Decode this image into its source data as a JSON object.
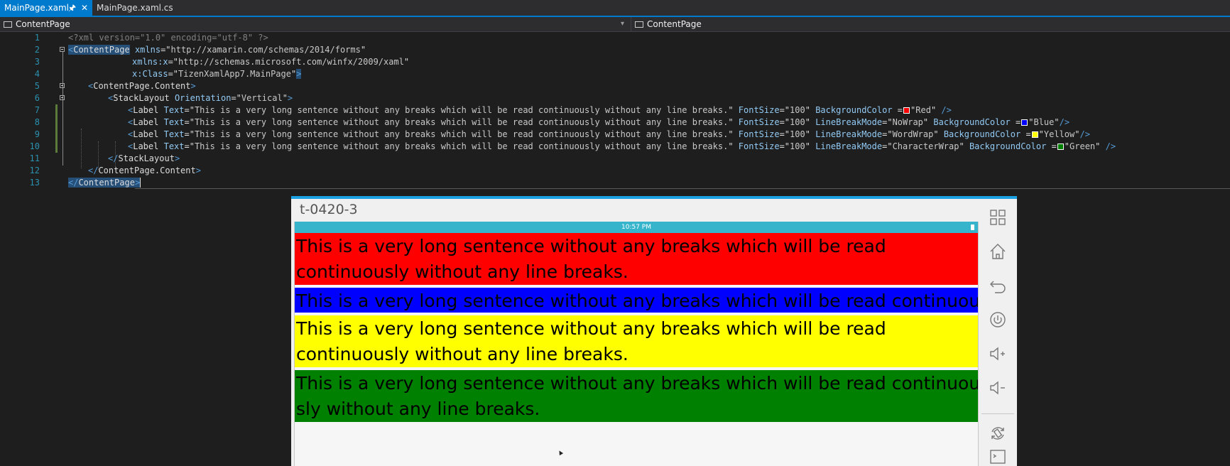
{
  "tabs": [
    {
      "label": "MainPage.xaml",
      "active": true
    },
    {
      "label": "MainPage.xaml.cs",
      "active": false
    }
  ],
  "nav": {
    "left": "ContentPage",
    "right": "ContentPage"
  },
  "editor": {
    "line_numbers": [
      "1",
      "2",
      "3",
      "4",
      "5",
      "6",
      "7",
      "8",
      "9",
      "10",
      "11",
      "12",
      "13"
    ],
    "l1": "<?xml version=\"1.0\" encoding=\"utf-8\" ?>",
    "l2": {
      "open": "<",
      "el": "ContentPage",
      "attr": "xmlns",
      "eq": "=\"",
      "val": "http://xamarin.com/schemas/2014/forms",
      "q": "\""
    },
    "l3": {
      "attr": "xmlns:x",
      "eq": "=\"",
      "val": "http://schemas.microsoft.com/winfx/2009/xaml",
      "q": "\""
    },
    "l4": {
      "attr": "x:Class",
      "eq": "=\"",
      "val": "TizenXamlApp7.MainPage",
      "q": "\"",
      "close": ">"
    },
    "l5": {
      "el": "ContentPage.Content"
    },
    "l6": {
      "el": "StackLayout",
      "attr": "Orientation",
      "val": "Vertical"
    },
    "label_text": "This is a very long sentence without any breaks which will be read continuously without any line breaks.",
    "fontsize": "100",
    "l7": {
      "color": "Red",
      "swatch": "#ff0000"
    },
    "l8": {
      "mode": "NoWrap",
      "color": "Blue",
      "swatch": "#0000ff"
    },
    "l9": {
      "mode": "WordWrap",
      "color": "Yellow",
      "swatch": "#ffff00"
    },
    "l10": {
      "mode": "CharacterWrap",
      "color": "Green",
      "swatch": "#008000"
    },
    "l11": {
      "el": "StackLayout"
    },
    "l12": {
      "el": "ContentPage.Content"
    },
    "l13": {
      "el": "ContentPage"
    },
    "kw": {
      "label": "Label",
      "text": "Text",
      "fs": "FontSize",
      "bg": "BackgroundColor",
      "lbm": "LineBreakMode"
    }
  },
  "emulator": {
    "title": "t-0420-3",
    "time": "10:57 PM",
    "labels": [
      {
        "line1": "This is a very long sentence without any breaks which will be read",
        "line2": "continuously without any line breaks.",
        "bg": "#ff0000"
      },
      {
        "line1": "This is a very long sentence without any breaks which will be read continuous",
        "bg": "#0000ff"
      },
      {
        "line1": "This is a very long sentence without any breaks which will be read",
        "line2": "continuously without any line breaks.",
        "bg": "#ffff00"
      },
      {
        "line1": "This is a very long sentence without any breaks which will be read continuou",
        "line2": "sly without any line breaks.",
        "bg": "#008000"
      }
    ],
    "side_buttons": [
      "grid-icon",
      "home-icon",
      "back-icon",
      "power-icon",
      "volume-up-icon",
      "volume-down-icon",
      "rotate-icon",
      "terminal-icon"
    ]
  },
  "colors": {
    "accent": "#007acc",
    "emulator_accent": "#1ba1e2",
    "status_bar": "#35b4cc"
  }
}
